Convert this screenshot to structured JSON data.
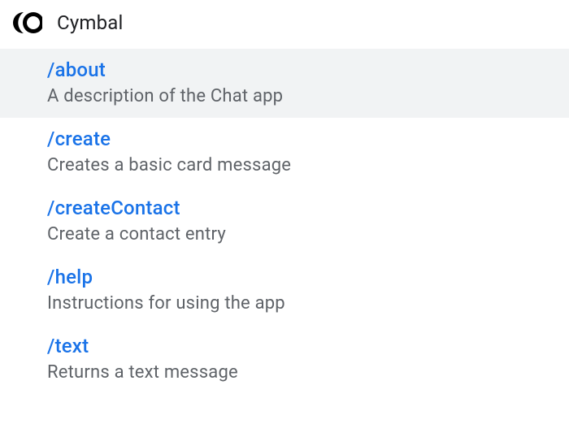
{
  "header": {
    "app_name": "Cymbal"
  },
  "commands": [
    {
      "name": "/about",
      "description": "A description of the Chat app",
      "selected": true
    },
    {
      "name": "/create",
      "description": "Creates a basic card message",
      "selected": false
    },
    {
      "name": "/createContact",
      "description": "Create a contact entry",
      "selected": false
    },
    {
      "name": "/help",
      "description": "Instructions for using the app",
      "selected": false
    },
    {
      "name": "/text",
      "description": "Returns a text message",
      "selected": false
    }
  ]
}
